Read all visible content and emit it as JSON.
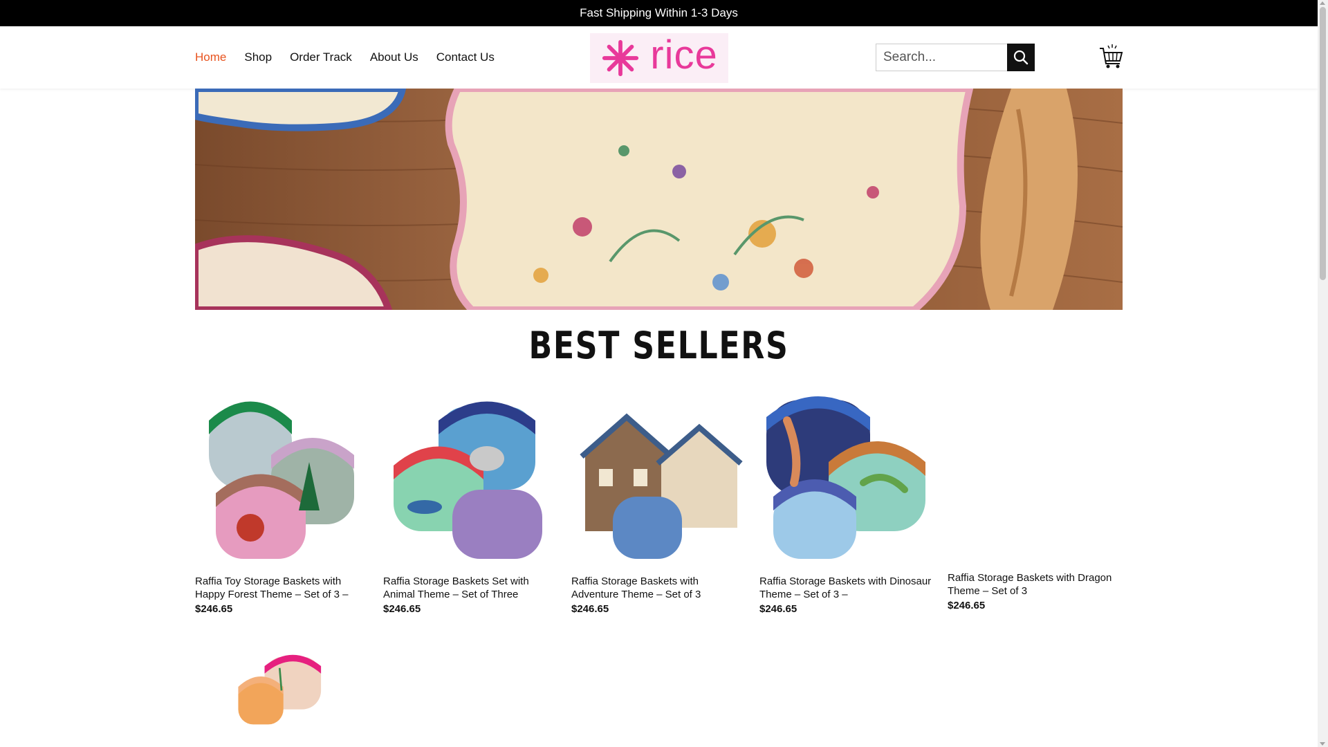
{
  "topbar": {
    "text": "Fast Shipping Within 1-3 Days"
  },
  "nav": {
    "items": [
      {
        "label": "Home",
        "active": true
      },
      {
        "label": "Shop",
        "active": false
      },
      {
        "label": "Order Track",
        "active": false
      },
      {
        "label": "About Us",
        "active": false
      },
      {
        "label": "Contact Us",
        "active": false
      }
    ]
  },
  "logo": {
    "text": "rice",
    "icon": "asterisk-star-icon",
    "color": "#e8399a"
  },
  "search": {
    "placeholder": "Search...",
    "icon": "search-icon"
  },
  "cart": {
    "icon": "cart-icon"
  },
  "section": {
    "title": "BEST SELLERS"
  },
  "products": [
    {
      "title": "Raffia Toy Storage Baskets with Happy Forest Theme – Set of 3 –",
      "price": "$246.65"
    },
    {
      "title": "Raffia Storage Baskets Set with Animal Theme – Set of Three",
      "price": "$246.65"
    },
    {
      "title": "Raffia Storage Baskets with Adventure Theme – Set of 3",
      "price": "$246.65"
    },
    {
      "title": "Raffia Storage Baskets with Dinosaur Theme – Set of 3 –",
      "price": "$246.65"
    },
    {
      "title": "Raffia Storage Baskets with Dragon Theme – Set of 3",
      "price": "$246.65"
    }
  ],
  "colors": {
    "accent": "#e8531e",
    "brand": "#e8399a"
  }
}
